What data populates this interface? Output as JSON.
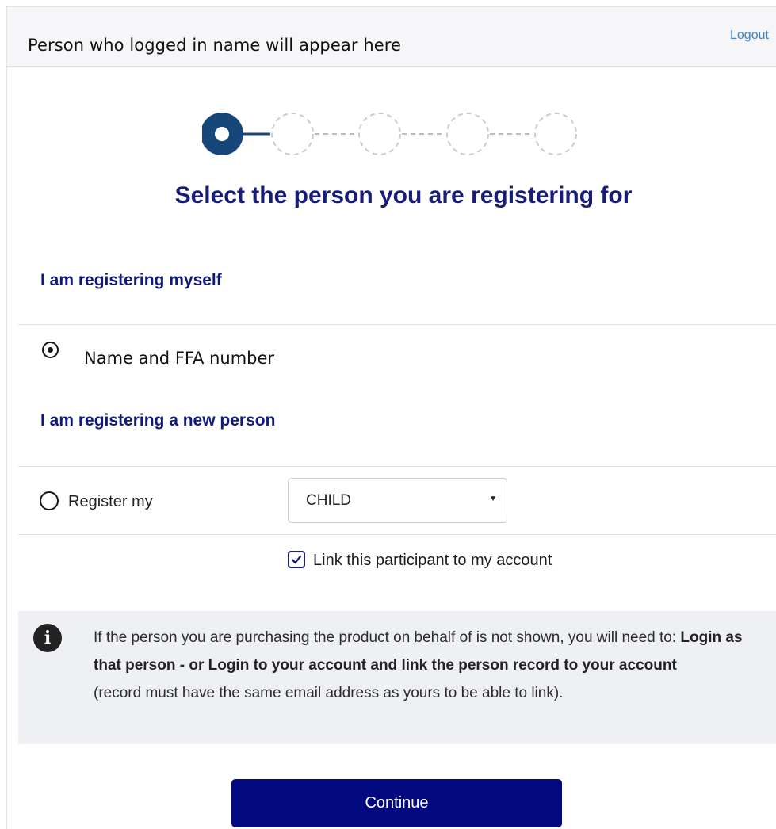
{
  "header": {
    "user_name": "Person who logged in name will appear here",
    "logout_label": "Logout"
  },
  "stepper": {
    "total_steps": 5,
    "current_step": 1,
    "active_color": "#17467a",
    "inactive_color": "#c9ccd2"
  },
  "title": "Select the person you are registering for",
  "self_section": {
    "heading": "I am registering myself",
    "option_label": "Name and FFA number",
    "selected": true
  },
  "new_person_section": {
    "heading": "I am registering a new person",
    "option_label": "Register my",
    "selected": false,
    "relation_select": {
      "value": "CHILD"
    },
    "link_checkbox": {
      "label": "Link this participant to my account",
      "checked": true
    }
  },
  "info": {
    "icon": "info-icon",
    "text_intro": "If the person you are purchasing the product on behalf of is not shown, you will need to: ",
    "text_bold": "Login as that person - or Login to your account and link the person record to your account",
    "text_note": "(record must have the same email address as yours to be able to link)."
  },
  "continue_label": "Continue",
  "colors": {
    "brand_navy": "#030a80",
    "heading_navy": "#171c74",
    "link_blue": "#3a86c9",
    "info_bg": "#eef0f4"
  }
}
